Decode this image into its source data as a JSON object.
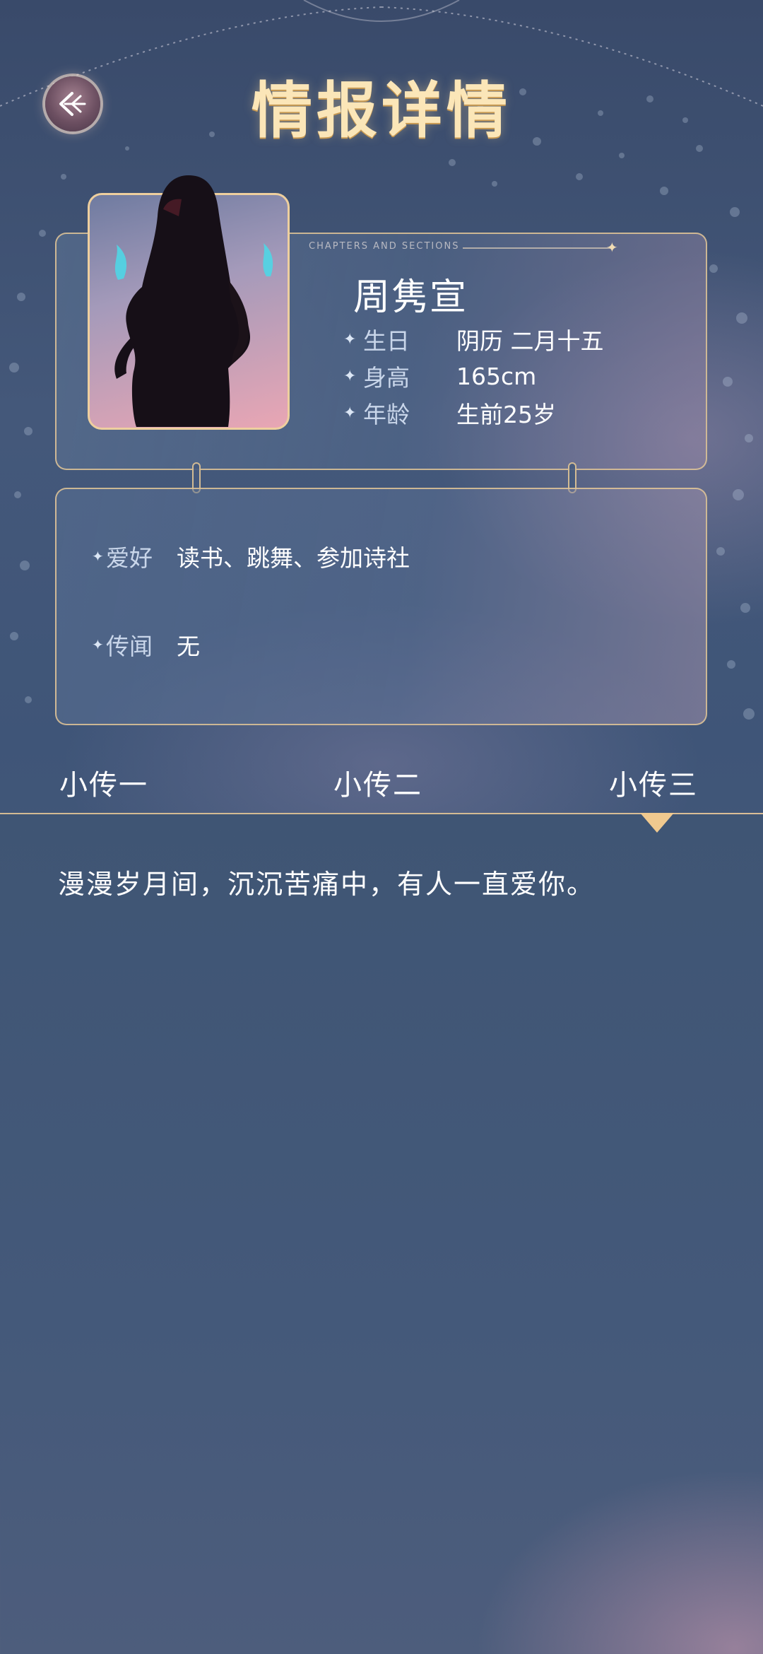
{
  "header": {
    "title": "情报详情",
    "back_icon": "back-arrow-icon"
  },
  "profile": {
    "chapters_label": "CHAPTERS AND SECTIONS",
    "name": "周隽宣",
    "fields": [
      {
        "label": "生日",
        "value": "阴历 二月十五"
      },
      {
        "label": "身高",
        "value": "165cm"
      },
      {
        "label": "年龄",
        "value": "生前25岁"
      }
    ]
  },
  "details": {
    "hobby": {
      "label": "爱好",
      "value": "读书、跳舞、参加诗社"
    },
    "rumor": {
      "label": "传闻",
      "value": "无"
    }
  },
  "tabs": [
    {
      "label": "小传一",
      "selected": false
    },
    {
      "label": "小传二",
      "selected": false
    },
    {
      "label": "小传三",
      "selected": true
    }
  ],
  "story": {
    "text": "漫漫岁月间，沉沉苦痛中，有人一直爱你。"
  },
  "colors": {
    "accent_gold": "#f0c98f",
    "title_gold": "#fbe6b8",
    "background": "#3f5578"
  }
}
